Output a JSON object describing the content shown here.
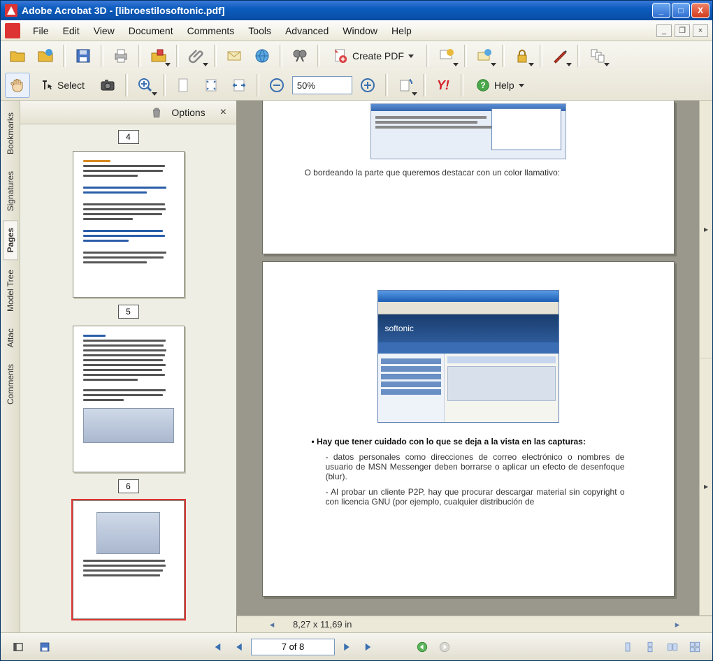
{
  "title": "Adobe Acrobat 3D - [libroestilosoftonic.pdf]",
  "menus": {
    "file": "File",
    "edit": "Edit",
    "view": "View",
    "document": "Document",
    "comments": "Comments",
    "tools": "Tools",
    "advanced": "Advanced",
    "window": "Window",
    "help": "Help"
  },
  "toolbar": {
    "create_pdf": "Create PDF",
    "select": "Select",
    "zoom_value": "50%",
    "help": "Help"
  },
  "yahoo": "Y!",
  "panel": {
    "options": "Options",
    "tabs": {
      "bookmarks": "Bookmarks",
      "signatures": "Signatures",
      "pages": "Pages",
      "model_tree": "Model Tree",
      "attachments": "Attac",
      "comments": "Comments"
    },
    "thumbs": {
      "p4": "4",
      "p5": "5",
      "p6": "6"
    }
  },
  "document": {
    "line1": "O bordeando la parte que queremos destacar con un color llamativo:",
    "bullet_lead": "Hay que tener cuidado con lo que se deja a la vista en las capturas:",
    "bullet_sub1": "datos personales como direcciones de correo electrónico o nombres de usuario de MSN Messenger deben borrarse o aplicar un efecto de desenfoque (blur).",
    "bullet_sub2": "Al probar un cliente P2P, hay que procurar descargar material sin copyright o con licencia GNU (por ejemplo, cualquier distribución de",
    "softonic": "softonic",
    "dimensions": "8,27 x 11,69 in"
  },
  "nav": {
    "page_of": "7 of 8"
  }
}
